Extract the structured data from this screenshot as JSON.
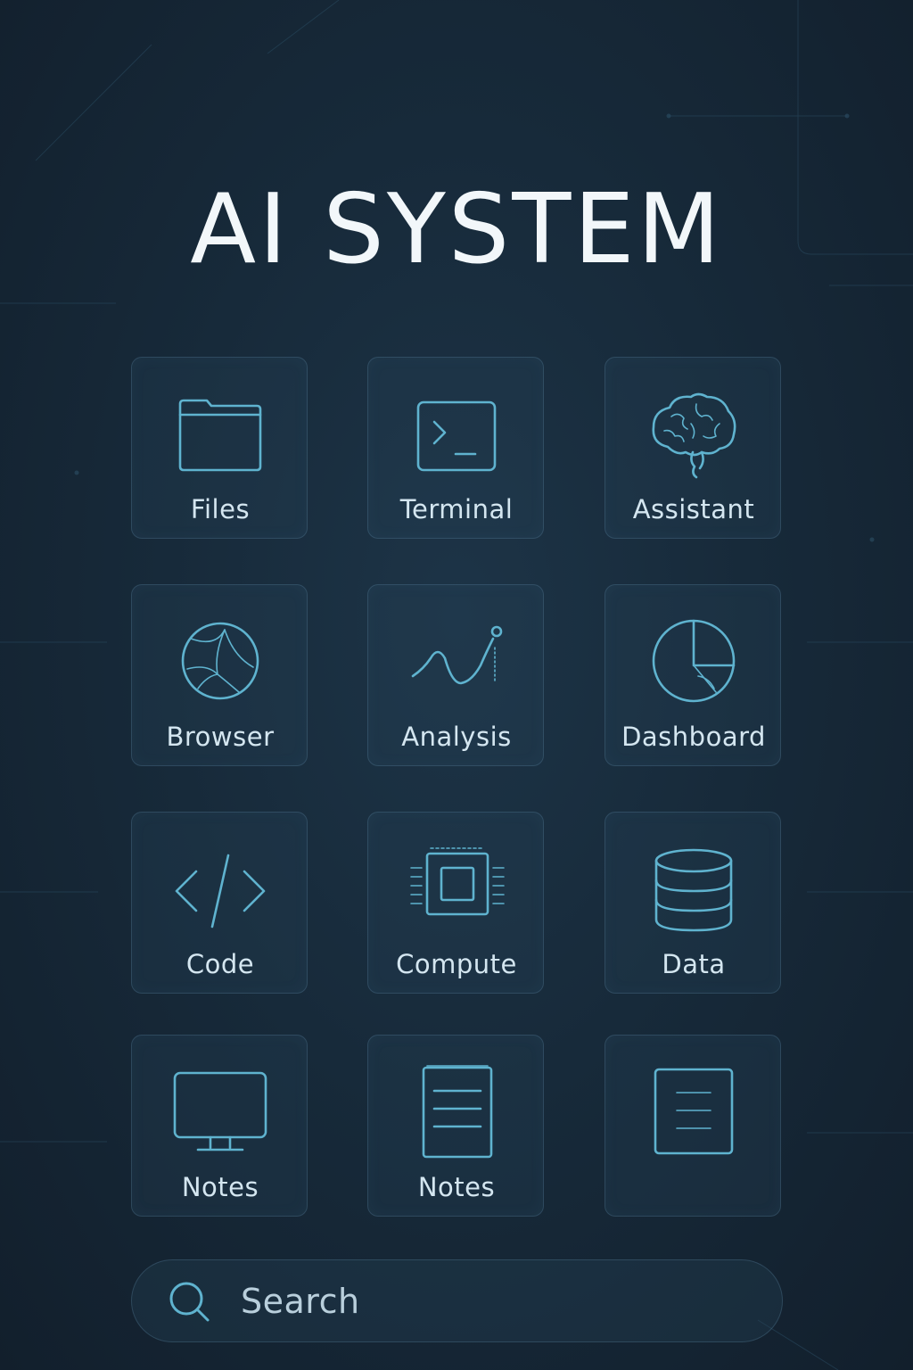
{
  "app": {
    "title": "AI SYSTEM"
  },
  "grid": {
    "tiles": [
      {
        "label": "Files",
        "icon": "folder-icon"
      },
      {
        "label": "Terminal",
        "icon": "terminal-icon"
      },
      {
        "label": "Assistant",
        "icon": "brain-icon"
      },
      {
        "label": "Browser",
        "icon": "globe-icon"
      },
      {
        "label": "Analysis",
        "icon": "line-chart-icon"
      },
      {
        "label": "Dashboard",
        "icon": "pie-chart-icon"
      },
      {
        "label": "Code",
        "icon": "code-icon"
      },
      {
        "label": "Compute",
        "icon": "cpu-chip-icon"
      },
      {
        "label": "Data",
        "icon": "database-icon"
      },
      {
        "label": "Notes",
        "icon": "monitor-icon"
      },
      {
        "label": "Notes",
        "icon": "notepad-icon"
      },
      {
        "label": "",
        "icon": "document-icon"
      }
    ]
  },
  "search": {
    "placeholder": "Search",
    "icon": "search-icon"
  },
  "colors": {
    "background": "#172a3a",
    "accent": "#5fb3cf",
    "title_text": "#f2f7fa",
    "label_text": "#d4e6f0"
  }
}
